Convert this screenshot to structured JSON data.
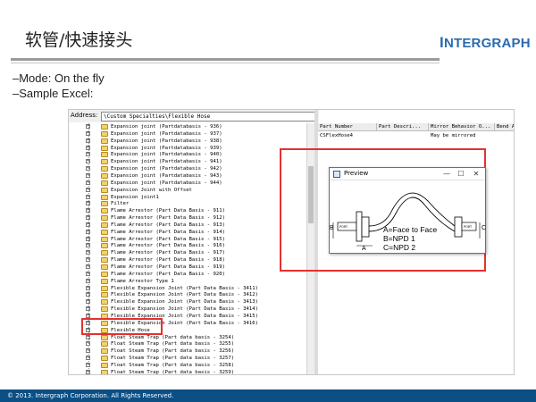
{
  "slide": {
    "title": "软管/快速接头",
    "logo_prefix": "I",
    "logo_rest": "NTERGRAPH",
    "bullets": [
      "–Mode: On the fly",
      "–Sample Excel:"
    ],
    "footer": "© 2013. Intergraph Corporation. All Rights Reserved."
  },
  "explorer": {
    "address_label": "Address:",
    "address_value": "\\Custom Specialties\\Flexible Hose",
    "tree_items": [
      "Expansion joint (Partdatabasis - 936)",
      "Expansion joint (Partdatabasis - 937)",
      "Expansion joint (Partdatabasis - 938)",
      "Expansion joint (Partdatabasis - 939)",
      "Expansion joint (Partdatabasis - 940)",
      "Expansion joint (Partdatabasis - 941)",
      "Expansion joint (Partdatabasis - 942)",
      "Expansion joint (Partdatabasis - 943)",
      "Expansion joint (Partdatabasis - 944)",
      "Expansion Joint with Offset",
      "Expansion joint1",
      "Filter",
      "Flame Arrestor (Part Data Basis - 911)",
      "Flame Arrestor (Part Data Basis - 912)",
      "Flame Arrestor (Part Data Basis - 913)",
      "Flame Arrestor (Part Data Basis - 914)",
      "Flame Arrestor (Part Data Basis - 915)",
      "Flame Arrestor (Part Data Basis - 916)",
      "Flame Arrestor (Part Data Basis - 917)",
      "Flame Arrestor (Part Data Basis - 918)",
      "Flame Arrestor (Part Data Basis - 919)",
      "Flame Arrestor (Part Data Basis - 920)",
      "Flame Arrestor Type 1",
      "Flexible Expansion Joint (Part Data Basis - 3411)",
      "Flexible Expansion Joint (Part Data Basis - 3412)",
      "Flexible Expansion Joint (Part Data Basis - 3413)",
      "Flexible Expansion Joint (Part Data Basis - 3414)",
      "Flexible Expansion Joint (Part Data Basis - 3415)",
      "Flexible Expansion Joint (Part Data Basis - 3416)",
      "Flexible Hose",
      "Float Steam Trap (Part data basis - 3254)",
      "Float Steam Trap (Part data basis - 3255)",
      "Float Steam Trap (Part data basis - 3256)",
      "Float Steam Trap (Part data basis - 3257)",
      "Float Steam Trap (Part data basis - 3258)",
      "Float Steam Trap (Part data basis - 3259)"
    ],
    "grid_headers": [
      "Part Number",
      "Part Descri...",
      "Mirror Behavior O...",
      "Bend A"
    ],
    "grid_row": [
      "CSFlexHose4",
      "",
      "May be mirrored",
      ""
    ]
  },
  "preview": {
    "title": "Preview",
    "min_glyph": "—",
    "max_glyph": "☐",
    "close_glyph": "✕",
    "legend": [
      "A=Face to Face",
      "B=NPD 1",
      "C=NPD 2"
    ],
    "port_left": "PORT",
    "port_right": "PORT",
    "dim_a": "A",
    "dim_b": "B",
    "dim_c": "C"
  }
}
